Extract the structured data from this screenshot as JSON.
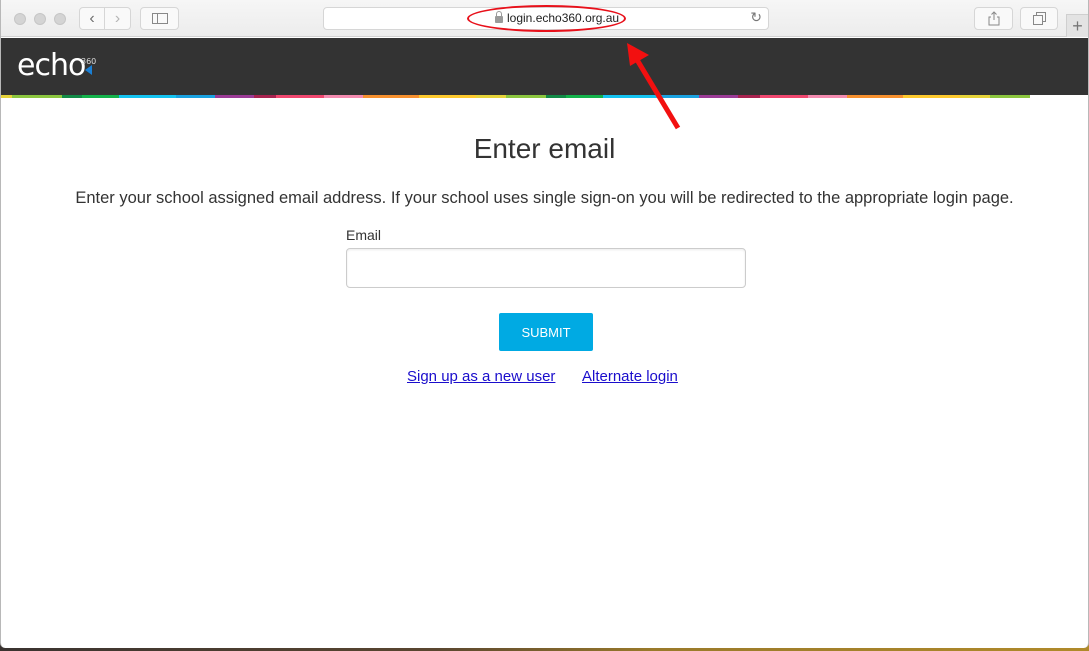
{
  "browser": {
    "url": "login.echo360.org.au",
    "buttons": {
      "back": "back",
      "forward": "forward",
      "sidebar": "sidebar",
      "reload": "reload",
      "share": "share",
      "tabs": "tabs",
      "new_tab": "+"
    },
    "icons": {
      "back": "‹",
      "forward": "›",
      "reload": "↻",
      "new_tab": "+"
    }
  },
  "header": {
    "logo_text": "echo",
    "logo_superscript": "360",
    "stripe_colors": [
      "#e6d33a",
      "#8cc63f",
      "#128a47",
      "#13b24b",
      "#14c3f0",
      "#1aa2e0",
      "#9b3b96",
      "#a8234f",
      "#f0476f",
      "#f48bb0",
      "#f7912f",
      "#fdc92d",
      "#e6d33a",
      "#8cc63f",
      "#128a47",
      "#13b24b",
      "#14c3f0",
      "#1aa2e0",
      "#9b3b96",
      "#a8234f",
      "#f0476f",
      "#f48bb0",
      "#f7912f",
      "#fdc92d",
      "#e6d33a",
      "#8cc63f"
    ]
  },
  "page": {
    "title": "Enter email",
    "description": "Enter your school assigned email address. If your school uses single sign-on you will be redirected to the appropriate login page.",
    "email_label": "Email",
    "email_value": "",
    "email_placeholder": "",
    "submit_label": "SUBMIT",
    "links": {
      "signup": "Sign up as a new user",
      "alternate": "Alternate login"
    }
  },
  "colors": {
    "accent": "#00aae3",
    "header_bg": "#333333",
    "link": "#1a0dcc",
    "annotation": "#e8101a"
  }
}
